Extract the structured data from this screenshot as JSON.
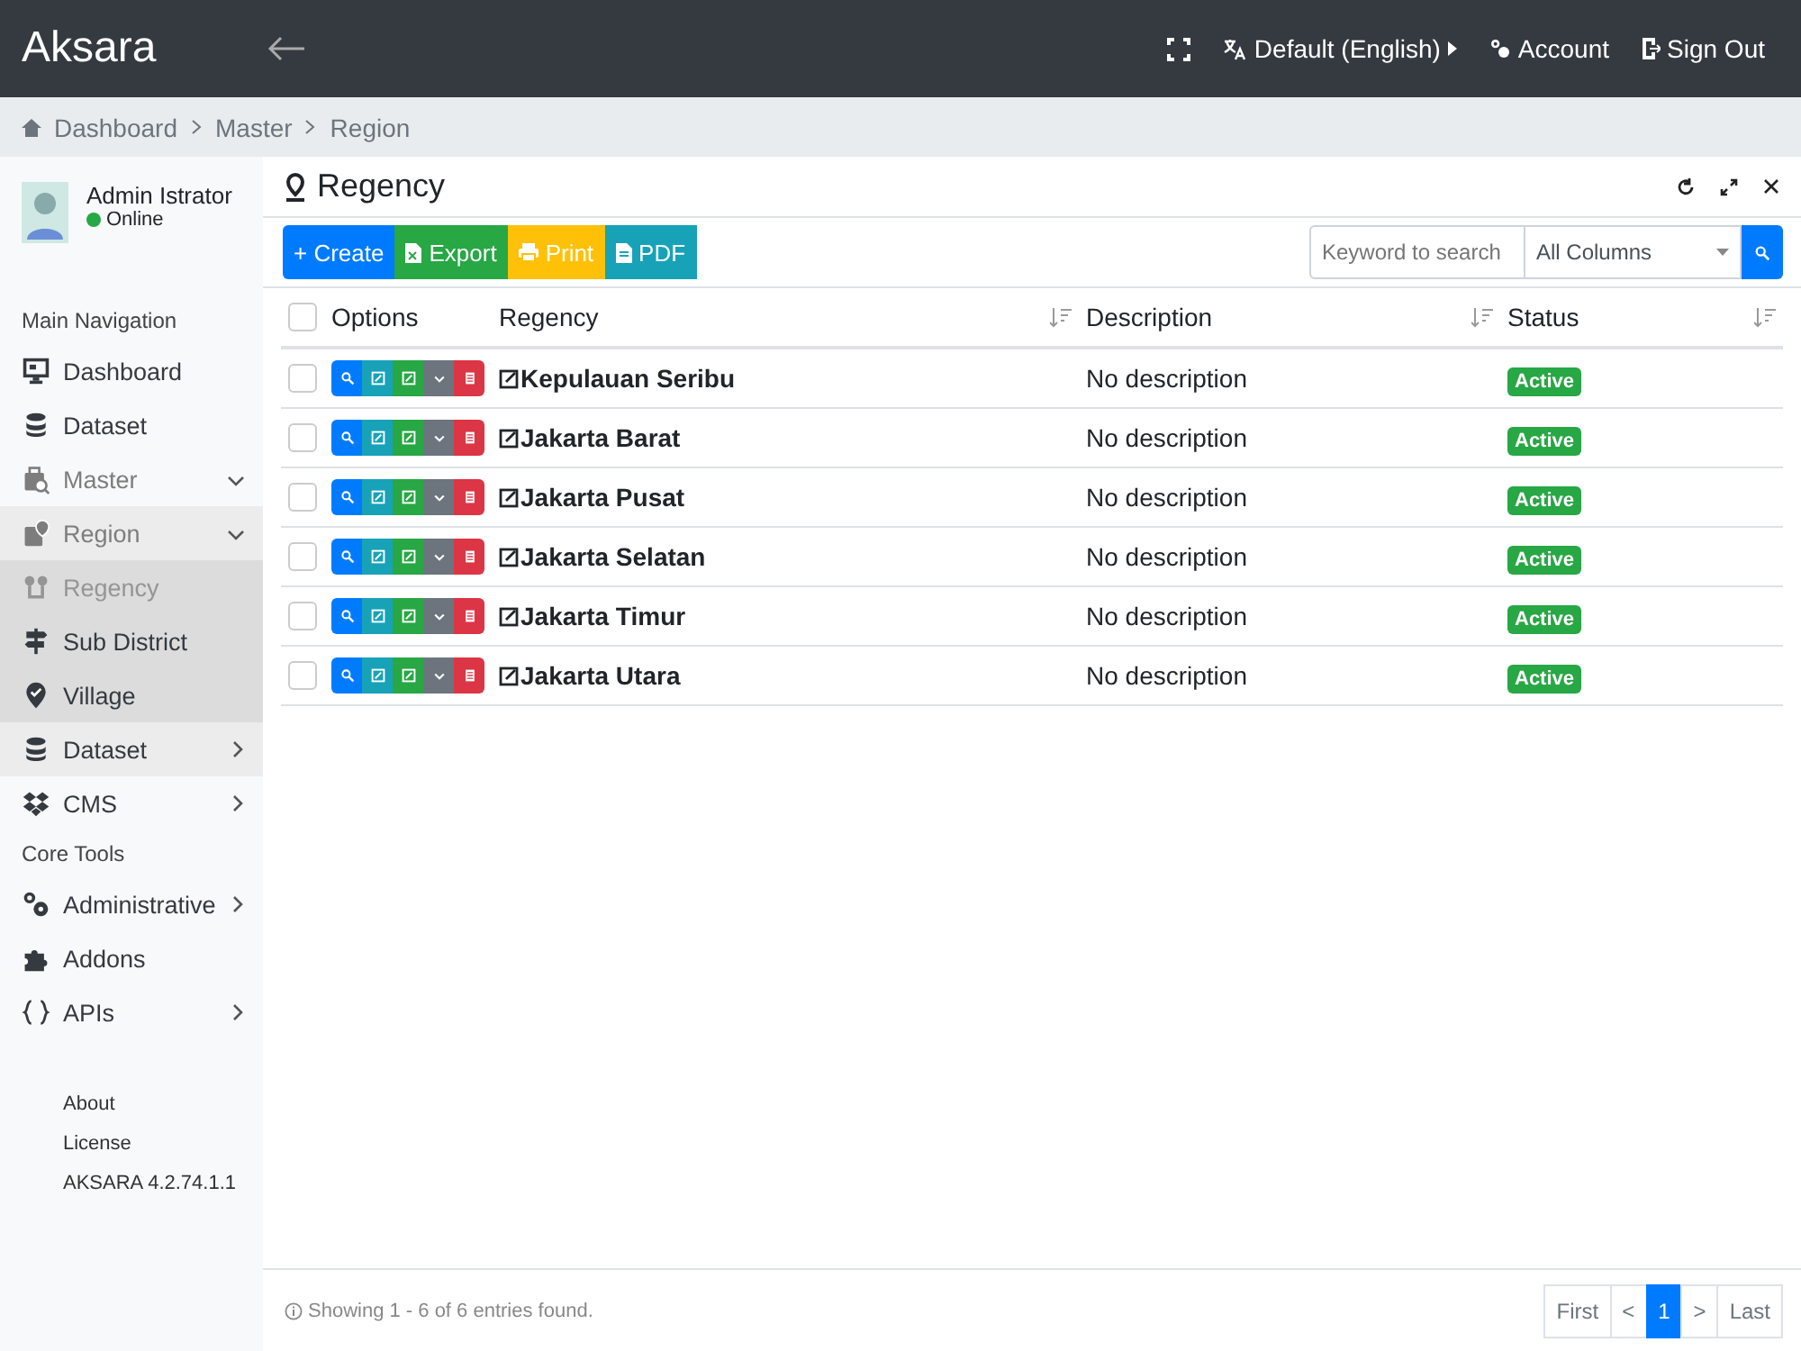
{
  "header": {
    "brand": "Aksara",
    "language": "Default (English)",
    "account": "Account",
    "sign_out": "Sign Out"
  },
  "breadcrumb": [
    "Dashboard",
    "Master",
    "Region"
  ],
  "user": {
    "name": "Admin Istrator",
    "status": "Online"
  },
  "sidebar": [
    {
      "kind": "header",
      "label": "Main Navigation"
    },
    {
      "kind": "item",
      "label": "Dashboard",
      "selected": false
    },
    {
      "kind": "item",
      "label": "Dataset",
      "selected": false
    },
    {
      "kind": "item",
      "label": "Master",
      "selected": false,
      "expanded": true,
      "children": [
        {
          "kind": "item",
          "label": "Region",
          "selected": false,
          "expanded": true,
          "children": [
            {
              "kind": "item",
              "label": "Regency",
              "selected": true
            },
            {
              "kind": "item",
              "label": "Sub District",
              "selected": false
            },
            {
              "kind": "item",
              "label": "Village",
              "selected": false
            }
          ]
        },
        {
          "kind": "item",
          "label": "Dataset",
          "selected": false,
          "expanded": false
        }
      ]
    },
    {
      "kind": "item",
      "label": "CMS",
      "selected": false,
      "expanded": false
    },
    {
      "kind": "header",
      "label": "Core Tools"
    },
    {
      "kind": "item",
      "label": "Administrative",
      "selected": false,
      "expanded": false
    },
    {
      "kind": "item",
      "label": "Addons",
      "selected": false
    },
    {
      "kind": "item",
      "label": "APIs",
      "selected": false,
      "expanded": false
    }
  ],
  "sidebar_footer": [
    "About",
    "License",
    "AKSARA 4.2.74.1.1"
  ],
  "panel": {
    "title": "Regency"
  },
  "toolbar": [
    {
      "kind": "create",
      "label": "+ Create"
    },
    {
      "kind": "export",
      "label": "Export"
    },
    {
      "kind": "print",
      "label": "Print"
    },
    {
      "kind": "pdf",
      "label": "PDF"
    }
  ],
  "search": {
    "placeholder": "Keyword to search",
    "column": "All Columns"
  },
  "table": {
    "select_all": {
      "checked": false
    },
    "columns": [
      "Options",
      "Regency",
      "Description",
      "Status"
    ],
    "rows": [
      {
        "regency": "Kepulauan Seribu",
        "description": "No description",
        "status": "Active",
        "checked": false
      },
      {
        "regency": "Jakarta Barat",
        "description": "No description",
        "status": "Active",
        "checked": false
      },
      {
        "regency": "Jakarta Pusat",
        "description": "No description",
        "status": "Active",
        "checked": false
      },
      {
        "regency": "Jakarta Selatan",
        "description": "No description",
        "status": "Active",
        "checked": false
      },
      {
        "regency": "Jakarta Timur",
        "description": "No description",
        "status": "Active",
        "checked": false
      },
      {
        "regency": "Jakarta Utara",
        "description": "No description",
        "status": "Active",
        "checked": false
      }
    ]
  },
  "footer": {
    "info": "Showing 1 - 6 of 6 entries found."
  },
  "pagination": [
    {
      "label": "First",
      "selected": false
    },
    {
      "label": "<",
      "selected": false
    },
    {
      "label": "1",
      "selected": true
    },
    {
      "label": ">",
      "selected": false
    },
    {
      "label": "Last",
      "selected": false
    }
  ]
}
